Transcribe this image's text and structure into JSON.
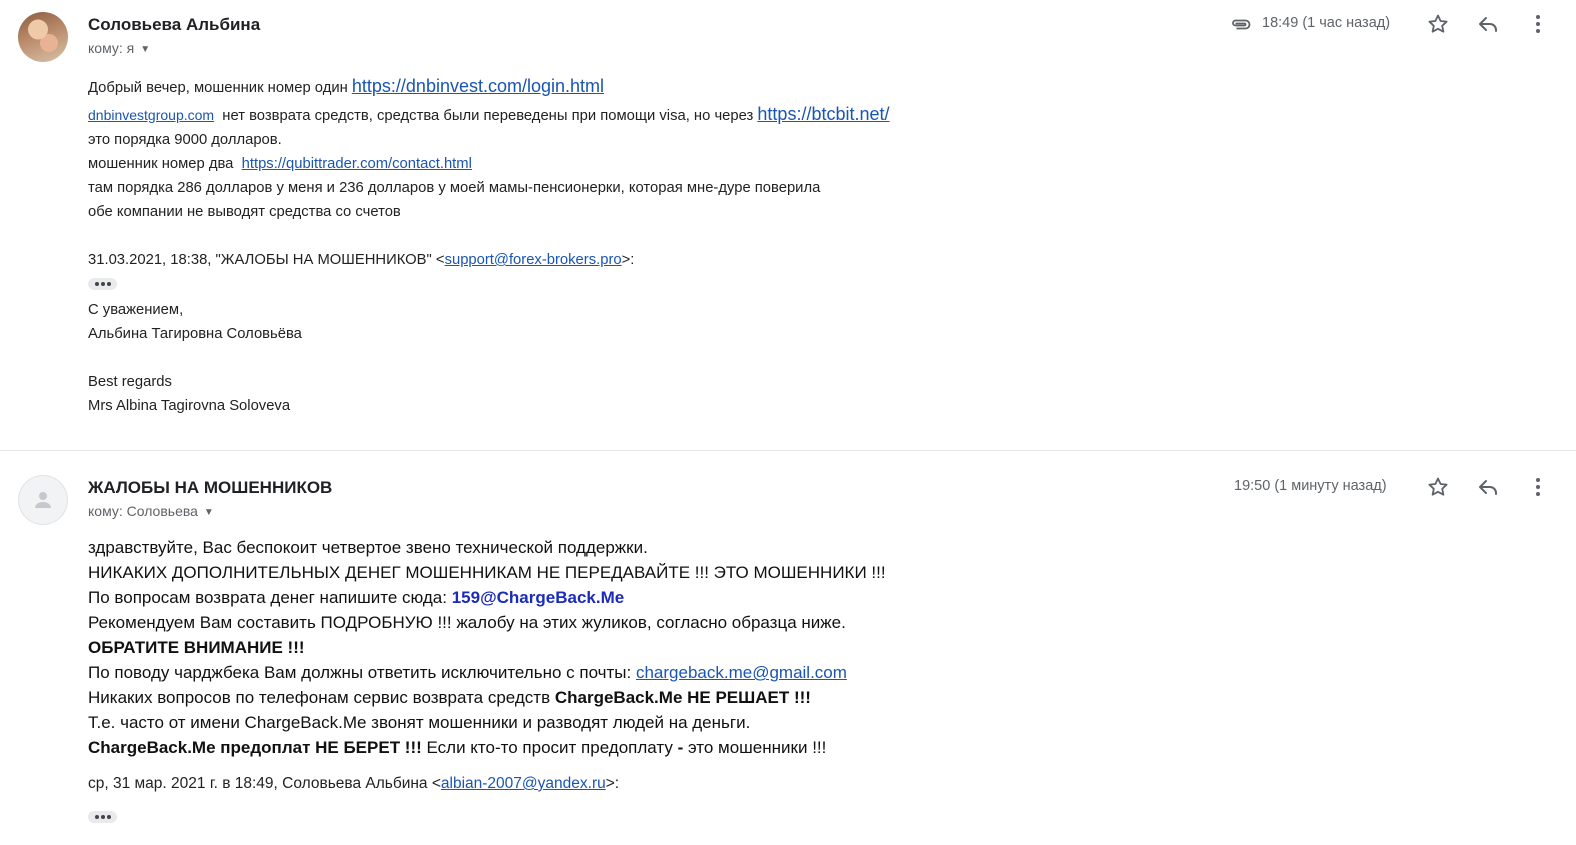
{
  "message1": {
    "sender": "Соловьева Альбина",
    "recipient": "кому: я",
    "time": "18:49 (1 час назад)",
    "icons": [
      "attachment-icon",
      "star-icon",
      "reply-icon",
      "more-icon"
    ],
    "line1_text": "Добрый вечер, мошенник номер один ",
    "line1_link": "https://dnbinvest.com/login.html",
    "line2_link": "dnbinvestgroup.com",
    "line2_text": "  нет возврата средств, средства были переведены при помощи visa, но через ",
    "line2_link2": "https://btcbit.net/",
    "line3": "это порядка 9000 долларов.",
    "line4_text": "мошенник номер два  ",
    "line4_link": "https://qubittrader.com/contact.html",
    "line5": "там порядка 286 долларов у меня и 236 долларов у моей мамы-пенсионерки, которая мне-дуре поверила",
    "line6": "обе компании не выводят средства со счетов",
    "quote_header_text": "31.03.2021, 18:38, \"ЖАЛОБЫ НА МОШЕННИКОВ\" <",
    "quote_header_link": "support@forex-brokers.pro",
    "quote_header_end": ">:",
    "sig1": "С уважением,",
    "sig2": "Альбина Тагировна Соловьёва",
    "sig3": "Best regards",
    "sig4": "Mrs Albina Tagirovna Soloveva"
  },
  "message2": {
    "sender": "ЖАЛОБЫ НА МОШЕННИКОВ",
    "recipient": "кому: Соловьева",
    "time": "19:50 (1 минуту назад)",
    "icons": [
      "star-icon",
      "reply-icon",
      "more-icon"
    ],
    "l1": "здравствуйте, Вас беспокоит четвертое звено технической поддержки.",
    "l2": "НИКАКИХ ДОПОЛНИТЕЛЬНЫХ ДЕНЕГ МОШЕННИКАМ НЕ ПЕРЕДАВАЙТЕ !!! ЭТО МОШЕННИКИ !!!",
    "l3_text": "По вопросам возврата денег напишите сюда: ",
    "l3_bold": "159@ChargeBack.Me",
    "l4": "Рекомендуем Вам составить ПОДРОБНУЮ !!! жалобу на этих жуликов, согласно образца ниже.",
    "l5": "ОБРАТИТЕ ВНИМАНИЕ !!!",
    "l6_text": "По поводу чарджбека Вам должны ответить исключительно с почты: ",
    "l6_link": "chargeback.me@gmail.com",
    "l7_text": "Никаких вопросов по телефонам сервис возврата средств ",
    "l7_bold": "ChargeBack.Me НЕ РЕШАЕТ !!!",
    "l8": "Т.е. часто от имени ChargeBack.Me звонят мошенники и разводят людей на деньги.",
    "l9_bold": "ChargeBack.Me предоплат НЕ БЕРЕТ !!!",
    "l9_text": " Если кто-то просит предоплату ",
    "l9_bold2": "-",
    "l9_end": " это мошенники !!!",
    "quote_text": "ср, 31 мар. 2021 г. в 18:49, Соловьева Альбина <",
    "quote_link": "albian-2007@yandex.ru",
    "quote_end": ">:"
  }
}
